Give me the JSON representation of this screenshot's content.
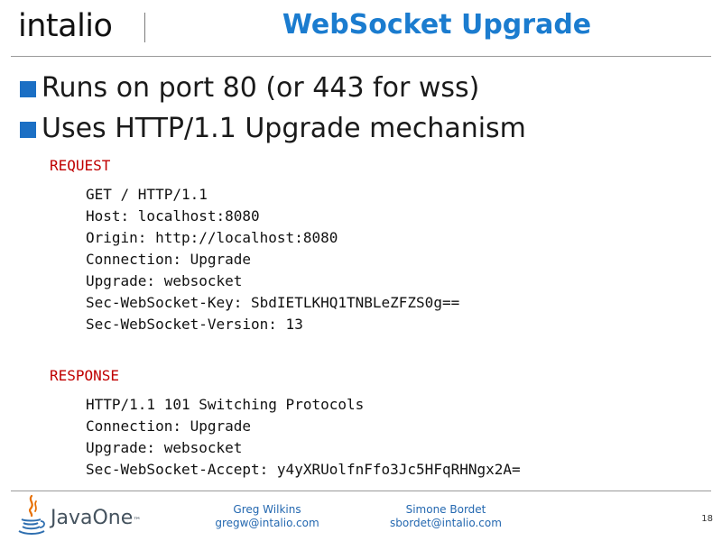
{
  "header": {
    "logo_text": "intalio",
    "title": "WebSocket Upgrade"
  },
  "bullets": [
    "Runs on port 80 (or 443 for wss)",
    "Uses HTTP/1.1 Upgrade mechanism"
  ],
  "request": {
    "label": "REQUEST",
    "lines": [
      "GET / HTTP/1.1",
      "Host: localhost:8080",
      "Origin: http://localhost:8080",
      "Connection: Upgrade",
      "Upgrade: websocket",
      "Sec-WebSocket-Key: SbdIETLKHQ1TNBLeZFZS0g==",
      "Sec-WebSocket-Version: 13"
    ]
  },
  "response": {
    "label": "RESPONSE",
    "lines": [
      "HTTP/1.1 101 Switching Protocols",
      "Connection: Upgrade",
      "Upgrade: websocket",
      "Sec-WebSocket-Accept: y4yXRUolfnFfo3Jc5HFqRHNgx2A="
    ]
  },
  "footer": {
    "brand": "JavaOne",
    "brand_mark": "™",
    "authors": [
      {
        "name": "Greg Wilkins",
        "email": "gregw@intalio.com"
      },
      {
        "name": "Simone Bordet",
        "email": "sbordet@intalio.com"
      }
    ],
    "slide_number": "18"
  },
  "colors": {
    "title": "#1b7ccf",
    "bullet": "#1b6fc4",
    "section_label": "#c00000",
    "author_text": "#2468b0",
    "javaone_text": "#44525e",
    "javaone_cup_orange": "#e76f00",
    "javaone_cup_blue": "#2f6fb0"
  },
  "icons": {
    "javaone_logo": "java-coffee-cup-icon",
    "bullet": "square-bullet"
  }
}
